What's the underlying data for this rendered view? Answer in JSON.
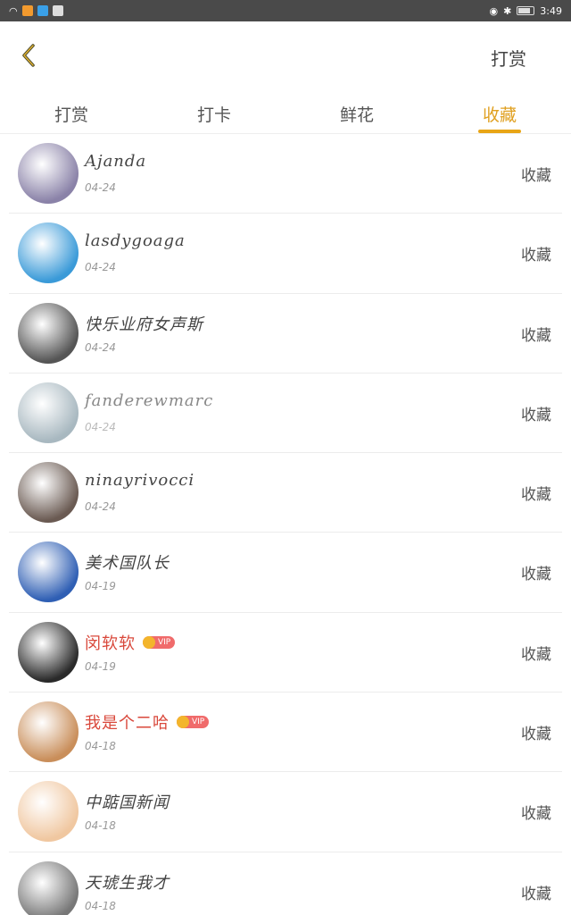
{
  "statusbar": {
    "time": "3:49",
    "battery": "77"
  },
  "header": {
    "action_label": "打赏"
  },
  "tabs": [
    {
      "label": "打赏",
      "active": false
    },
    {
      "label": "打卡",
      "active": false
    },
    {
      "label": "鲜花",
      "active": false
    },
    {
      "label": "收藏",
      "active": true
    }
  ],
  "colors": {
    "accent": "#e8a516",
    "vip_name": "#d9483b",
    "vip_badge": "#f06b6b"
  },
  "items": [
    {
      "name": "Ajanda",
      "date": "04-24",
      "action": "收藏",
      "vip": false,
      "faded": false,
      "avatar_color": "#8a82a8"
    },
    {
      "name": "lasdygoaga",
      "date": "04-24",
      "action": "收藏",
      "vip": false,
      "faded": false,
      "avatar_color": "#3a9ad8"
    },
    {
      "name": "快乐业府女声斯",
      "date": "04-24",
      "action": "收藏",
      "vip": false,
      "faded": false,
      "avatar_color": "#555555"
    },
    {
      "name": "fanderewmarc",
      "date": "04-24",
      "action": "收藏",
      "vip": false,
      "faded": true,
      "avatar_color": "#a8b8c0"
    },
    {
      "name": "ninayrivocci",
      "date": "04-24",
      "action": "收藏",
      "vip": false,
      "faded": false,
      "avatar_color": "#6a5a52"
    },
    {
      "name": "美术国队长",
      "date": "04-19",
      "action": "收藏",
      "vip": false,
      "faded": false,
      "avatar_color": "#2f5fb4"
    },
    {
      "name": "闵软软",
      "date": "04-19",
      "action": "收藏",
      "vip": true,
      "vip_label": "VIP",
      "faded": false,
      "avatar_color": "#2a2a2a"
    },
    {
      "name": "我是个二哈",
      "date": "04-18",
      "action": "收藏",
      "vip": true,
      "vip_label": "VIP",
      "faded": false,
      "avatar_color": "#c98e5a"
    },
    {
      "name": "中踮国新闻",
      "date": "04-18",
      "action": "收藏",
      "vip": false,
      "faded": false,
      "avatar_color": "#f0c7a0"
    },
    {
      "name": "天琥生我才",
      "date": "04-18",
      "action": "收藏",
      "vip": false,
      "faded": false,
      "avatar_color": "#777777"
    }
  ]
}
